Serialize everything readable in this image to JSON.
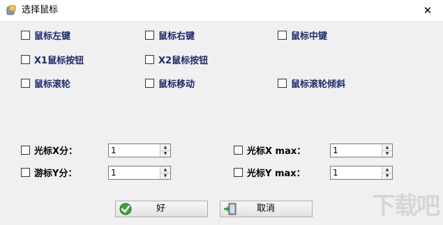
{
  "window": {
    "title": "选择鼠标",
    "close_glyph": "✕",
    "icon": "mouse-app-icon"
  },
  "checkboxes": {
    "row1": [
      "鼠标左键",
      "鼠标右键",
      "鼠标中键"
    ],
    "row2": [
      "X1鼠标按钮",
      "X2鼠标按钮"
    ],
    "row3": [
      "鼠标滚轮",
      "鼠标移动",
      "鼠标滚轮倾斜"
    ]
  },
  "fields": {
    "cursor_x_label": "光标X分：",
    "cursor_x_value": "1",
    "cursor_xmax_label": "光标X max：",
    "cursor_xmax_value": "1",
    "cursor_y_label": "游标Y分：",
    "cursor_y_value": "1",
    "cursor_ymax_label": "光标Y max：",
    "cursor_ymax_value": "1"
  },
  "buttons": {
    "ok_label": "好",
    "ok_icon": "green-check-icon",
    "cancel_label": "取消",
    "cancel_icon": "exit-door-icon"
  },
  "watermark": {
    "text": "下载吧"
  },
  "colors": {
    "label_text": "#1e2a6e",
    "client_bg": "#f0f0f0"
  }
}
